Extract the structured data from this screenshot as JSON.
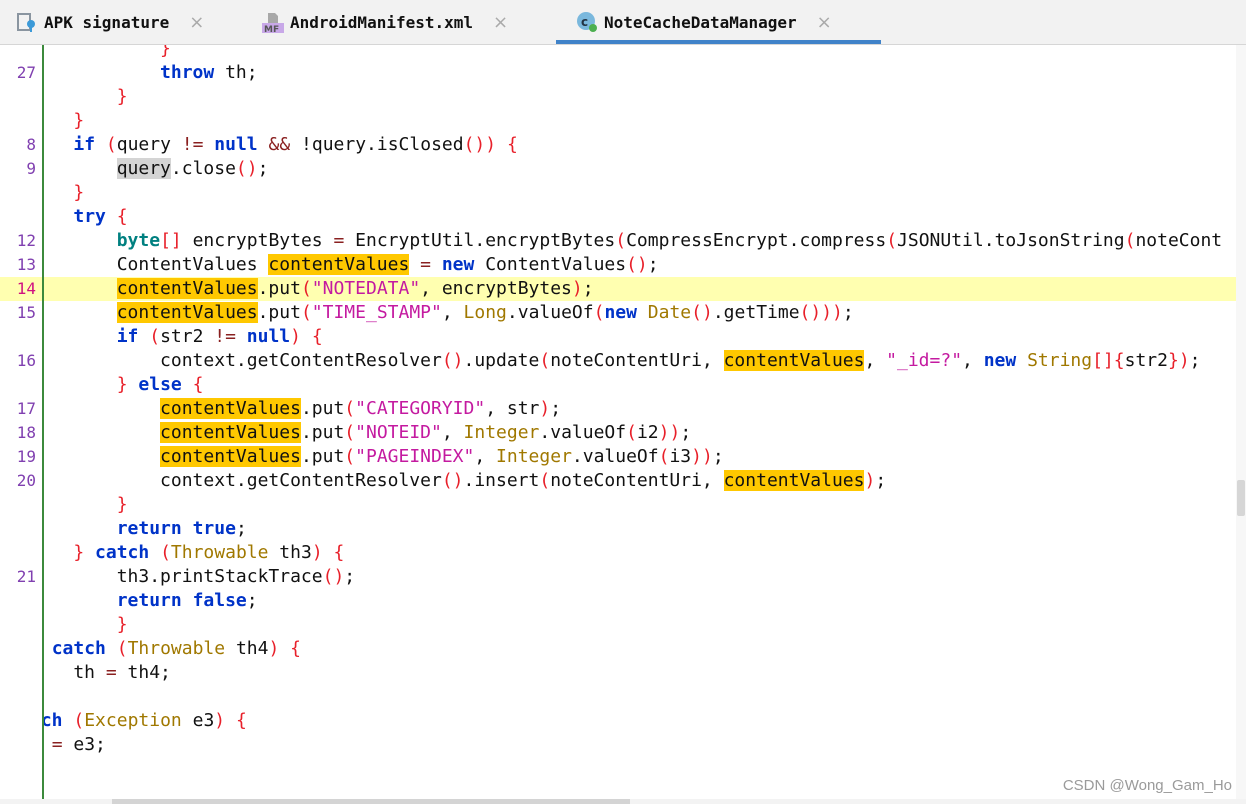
{
  "tabs": [
    {
      "label": "APK signature",
      "icon": "apk-signature-icon",
      "close": "×"
    },
    {
      "label": "AndroidManifest.xml",
      "icon": "manifest-file-icon",
      "icon_text": "MF",
      "close": "×"
    },
    {
      "label": "NoteCacheDataManager",
      "icon": "java-class-icon",
      "icon_text": "c",
      "close": "×",
      "active": true
    }
  ],
  "colors": {
    "accent": "#4083c9",
    "highlight": "#ffc800",
    "current_line": "#ffffb0",
    "keyword": "#0033c8",
    "string": "#c41aa0"
  },
  "editor": {
    "current_line_number": "14",
    "lines": [
      {
        "num": "",
        "tokens": [
          [
            "",
            "            "
          ],
          [
            "p",
            "}"
          ]
        ]
      },
      {
        "num": "27",
        "tokens": [
          [
            "",
            "            "
          ],
          [
            "k",
            "throw"
          ],
          [
            "",
            " th;"
          ]
        ]
      },
      {
        "num": "",
        "tokens": [
          [
            "",
            "        "
          ],
          [
            "p",
            "}"
          ]
        ]
      },
      {
        "num": "",
        "tokens": [
          [
            "",
            "    "
          ],
          [
            "p",
            "}"
          ]
        ]
      },
      {
        "num": "8",
        "tokens": [
          [
            "",
            "    "
          ],
          [
            "k",
            "if"
          ],
          [
            "",
            " "
          ],
          [
            "p",
            "("
          ],
          [
            "",
            "query "
          ],
          [
            "o",
            "!="
          ],
          [
            "",
            " "
          ],
          [
            "k",
            "null"
          ],
          [
            "",
            " "
          ],
          [
            "o",
            "&&"
          ],
          [
            "",
            " !query.isClosed"
          ],
          [
            "p",
            "())"
          ],
          [
            "",
            " "
          ],
          [
            "p",
            "{"
          ]
        ]
      },
      {
        "num": "9",
        "tokens": [
          [
            "",
            "        "
          ],
          [
            "q",
            "query"
          ],
          [
            "",
            ".close"
          ],
          [
            "p",
            "()"
          ],
          [
            "",
            ";"
          ]
        ]
      },
      {
        "num": "",
        "tokens": [
          [
            "",
            "    "
          ],
          [
            "p",
            "}"
          ]
        ]
      },
      {
        "num": "",
        "tokens": [
          [
            "",
            "    "
          ],
          [
            "k",
            "try"
          ],
          [
            "",
            " "
          ],
          [
            "p",
            "{"
          ]
        ]
      },
      {
        "num": "12",
        "tokens": [
          [
            "",
            "        "
          ],
          [
            "b",
            "byte"
          ],
          [
            "p",
            "[]"
          ],
          [
            "",
            " encryptBytes "
          ],
          [
            "o",
            "="
          ],
          [
            "",
            " EncryptUtil.encryptBytes"
          ],
          [
            "p",
            "("
          ],
          [
            "",
            "CompressEncrypt.compress"
          ],
          [
            "p",
            "("
          ],
          [
            "",
            "JSONUtil.toJsonString"
          ],
          [
            "p",
            "("
          ],
          [
            "",
            "noteCont"
          ]
        ]
      },
      {
        "num": "13",
        "tokens": [
          [
            "",
            "        ContentValues "
          ],
          [
            "hl",
            "contentValues"
          ],
          [
            "",
            " "
          ],
          [
            "o",
            "="
          ],
          [
            "",
            " "
          ],
          [
            "k",
            "new"
          ],
          [
            "",
            " ContentValues"
          ],
          [
            "p",
            "()"
          ],
          [
            "",
            ";"
          ]
        ]
      },
      {
        "num": "14",
        "current": true,
        "tokens": [
          [
            "",
            "        "
          ],
          [
            "hl",
            "contentValues"
          ],
          [
            "",
            ".put"
          ],
          [
            "p",
            "("
          ],
          [
            "s",
            "\"NOTEDATA\""
          ],
          [
            "",
            ", encryptBytes"
          ],
          [
            "p",
            ")"
          ],
          [
            "",
            ";"
          ]
        ]
      },
      {
        "num": "15",
        "tokens": [
          [
            "",
            "        "
          ],
          [
            "hl",
            "contentValues"
          ],
          [
            "",
            ".put"
          ],
          [
            "p",
            "("
          ],
          [
            "s",
            "\"TIME_STAMP\""
          ],
          [
            "",
            ", "
          ],
          [
            "t",
            "Long"
          ],
          [
            "",
            ".valueOf"
          ],
          [
            "p",
            "("
          ],
          [
            "k",
            "new"
          ],
          [
            "",
            " "
          ],
          [
            "t",
            "Date"
          ],
          [
            "p",
            "()"
          ],
          [
            "",
            ".getTime"
          ],
          [
            "p",
            "()))"
          ],
          [
            "",
            ";"
          ]
        ]
      },
      {
        "num": "",
        "tokens": [
          [
            "",
            "        "
          ],
          [
            "k",
            "if"
          ],
          [
            "",
            " "
          ],
          [
            "p",
            "("
          ],
          [
            "",
            "str2 "
          ],
          [
            "o",
            "!="
          ],
          [
            "",
            " "
          ],
          [
            "k",
            "null"
          ],
          [
            "p",
            ")"
          ],
          [
            "",
            " "
          ],
          [
            "p",
            "{"
          ]
        ]
      },
      {
        "num": "16",
        "tokens": [
          [
            "",
            "            context.getContentResolver"
          ],
          [
            "p",
            "()"
          ],
          [
            "",
            ".update"
          ],
          [
            "p",
            "("
          ],
          [
            "",
            "noteContentUri, "
          ],
          [
            "hl",
            "contentValues"
          ],
          [
            "",
            ", "
          ],
          [
            "s",
            "\"_id=?\""
          ],
          [
            "",
            ", "
          ],
          [
            "k",
            "new"
          ],
          [
            "",
            " "
          ],
          [
            "t",
            "String"
          ],
          [
            "p",
            "[]{"
          ],
          [
            "",
            "str2"
          ],
          [
            "p",
            "})"
          ],
          [
            "",
            ";"
          ]
        ]
      },
      {
        "num": "",
        "tokens": [
          [
            "",
            "        "
          ],
          [
            "p",
            "}"
          ],
          [
            "",
            " "
          ],
          [
            "k",
            "else"
          ],
          [
            "",
            " "
          ],
          [
            "p",
            "{"
          ]
        ]
      },
      {
        "num": "17",
        "tokens": [
          [
            "",
            "            "
          ],
          [
            "hl",
            "contentValues"
          ],
          [
            "",
            ".put"
          ],
          [
            "p",
            "("
          ],
          [
            "s",
            "\"CATEGORYID\""
          ],
          [
            "",
            ", str"
          ],
          [
            "p",
            ")"
          ],
          [
            "",
            ";"
          ]
        ]
      },
      {
        "num": "18",
        "tokens": [
          [
            "",
            "            "
          ],
          [
            "hl",
            "contentValues"
          ],
          [
            "",
            ".put"
          ],
          [
            "p",
            "("
          ],
          [
            "s",
            "\"NOTEID\""
          ],
          [
            "",
            ", "
          ],
          [
            "t",
            "Integer"
          ],
          [
            "",
            ".valueOf"
          ],
          [
            "p",
            "("
          ],
          [
            "",
            "i2"
          ],
          [
            "p",
            "))"
          ],
          [
            "",
            ";"
          ]
        ]
      },
      {
        "num": "19",
        "tokens": [
          [
            "",
            "            "
          ],
          [
            "hl",
            "contentValues"
          ],
          [
            "",
            ".put"
          ],
          [
            "p",
            "("
          ],
          [
            "s",
            "\"PAGEINDEX\""
          ],
          [
            "",
            ", "
          ],
          [
            "t",
            "Integer"
          ],
          [
            "",
            ".valueOf"
          ],
          [
            "p",
            "("
          ],
          [
            "",
            "i3"
          ],
          [
            "p",
            "))"
          ],
          [
            "",
            ";"
          ]
        ]
      },
      {
        "num": "20",
        "tokens": [
          [
            "",
            "            context.getContentResolver"
          ],
          [
            "p",
            "()"
          ],
          [
            "",
            ".insert"
          ],
          [
            "p",
            "("
          ],
          [
            "",
            "noteContentUri, "
          ],
          [
            "hl",
            "contentValues"
          ],
          [
            "p",
            ")"
          ],
          [
            "",
            ";"
          ]
        ]
      },
      {
        "num": "",
        "tokens": [
          [
            "",
            "        "
          ],
          [
            "p",
            "}"
          ]
        ]
      },
      {
        "num": "",
        "tokens": [
          [
            "",
            "        "
          ],
          [
            "k",
            "return"
          ],
          [
            "",
            " "
          ],
          [
            "k",
            "true"
          ],
          [
            "",
            ";"
          ]
        ]
      },
      {
        "num": "",
        "tokens": [
          [
            "",
            "    "
          ],
          [
            "p",
            "}"
          ],
          [
            "",
            " "
          ],
          [
            "k",
            "catch"
          ],
          [
            "",
            " "
          ],
          [
            "p",
            "("
          ],
          [
            "t",
            "Throwable"
          ],
          [
            "",
            " th3"
          ],
          [
            "p",
            ")"
          ],
          [
            "",
            " "
          ],
          [
            "p",
            "{"
          ]
        ]
      },
      {
        "num": "21",
        "tokens": [
          [
            "",
            "        th3.printStackTrace"
          ],
          [
            "p",
            "()"
          ],
          [
            "",
            ";"
          ]
        ]
      },
      {
        "num": "",
        "tokens": [
          [
            "",
            "        "
          ],
          [
            "k",
            "return"
          ],
          [
            "",
            " "
          ],
          [
            "k",
            "false"
          ],
          [
            "",
            ";"
          ]
        ]
      },
      {
        "num": "",
        "tokens": [
          [
            "",
            "        "
          ],
          [
            "p",
            "}"
          ]
        ]
      },
      {
        "num": "",
        "tokens": [
          [
            "",
            "  "
          ],
          [
            "k",
            "catch"
          ],
          [
            "",
            " "
          ],
          [
            "p",
            "("
          ],
          [
            "t",
            "Throwable"
          ],
          [
            "",
            " th4"
          ],
          [
            "p",
            ")"
          ],
          [
            "",
            " "
          ],
          [
            "p",
            "{"
          ]
        ]
      },
      {
        "num": "",
        "tokens": [
          [
            "",
            "    th "
          ],
          [
            "o",
            "="
          ],
          [
            "",
            " th4;"
          ]
        ]
      },
      {
        "num": "",
        "tokens": []
      },
      {
        "num": "",
        "tokens": [
          [
            "",
            " "
          ],
          [
            "k",
            "ch"
          ],
          [
            "",
            " "
          ],
          [
            "p",
            "("
          ],
          [
            "t",
            "Exception"
          ],
          [
            "",
            " e3"
          ],
          [
            "p",
            ")"
          ],
          [
            "",
            " "
          ],
          [
            "p",
            "{"
          ]
        ]
      },
      {
        "num": "",
        "tokens": [
          [
            "",
            "  "
          ],
          [
            "o",
            "="
          ],
          [
            "",
            " e3;"
          ]
        ]
      }
    ]
  },
  "watermark": "CSDN @Wong_Gam_Ho"
}
